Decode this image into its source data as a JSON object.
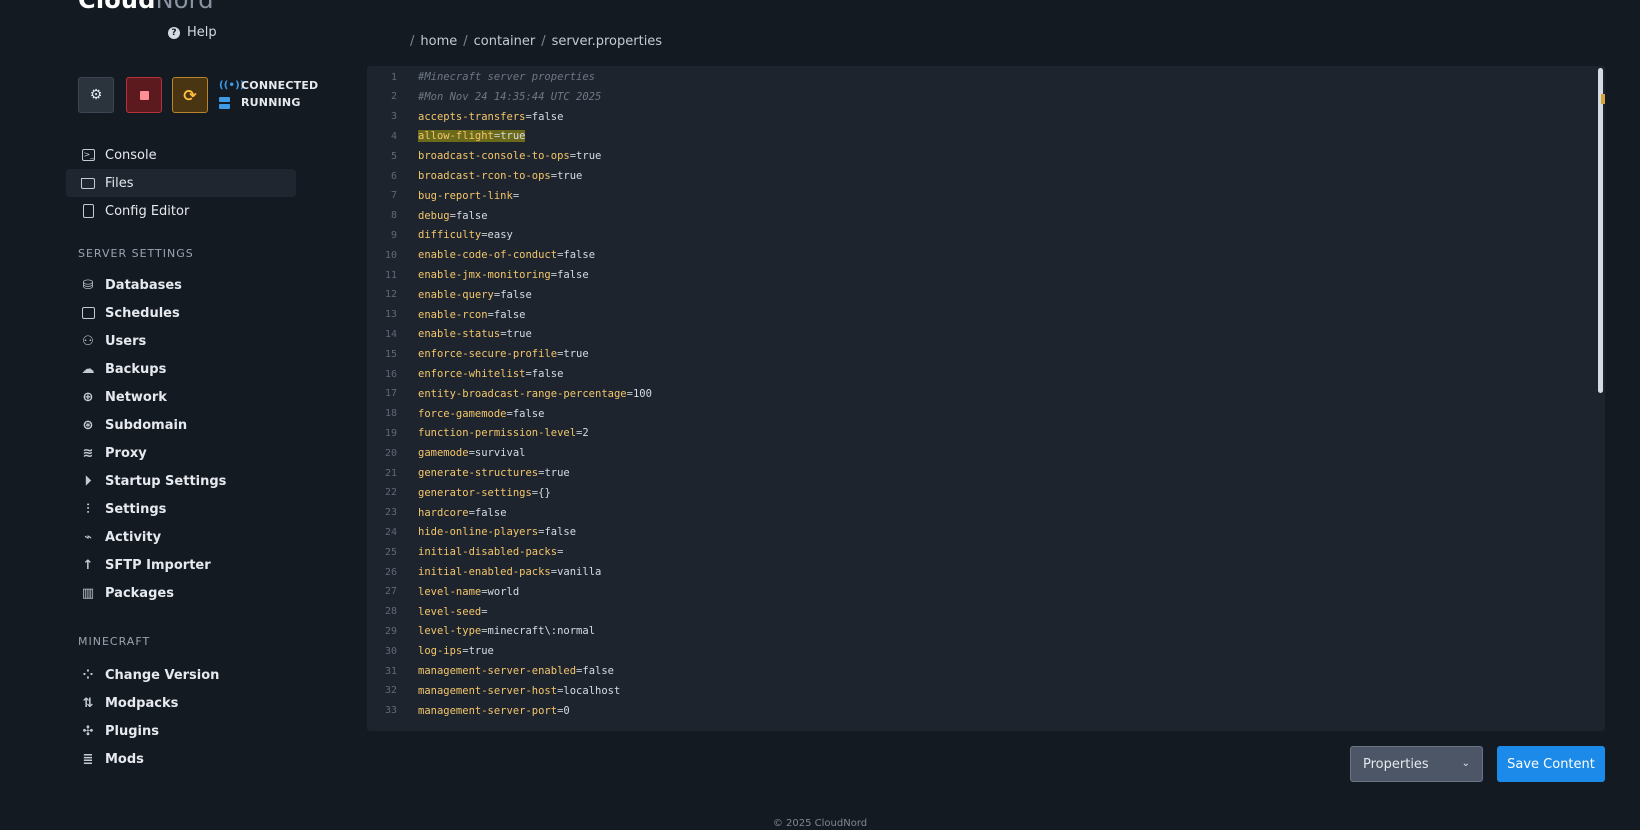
{
  "brand": {
    "primary": "Cloud",
    "secondary": "Nord"
  },
  "help_label": "Help",
  "controls": {
    "gear_icon": "gear-icon",
    "stop_icon": "stop-icon",
    "restart_icon": "restart-icon"
  },
  "status": {
    "connection": "CONNECTED",
    "state": "RUNNING",
    "accent": "#3d9be8"
  },
  "nav_top": [
    {
      "label": "Console",
      "icon": "terminal-icon"
    },
    {
      "label": "Files",
      "icon": "folder-icon",
      "active": true
    },
    {
      "label": "Config Editor",
      "icon": "clipboard-icon"
    }
  ],
  "section_server": "SERVER SETTINGS",
  "nav_server": [
    {
      "label": "Databases",
      "icon": "database-icon"
    },
    {
      "label": "Schedules",
      "icon": "calendar-icon"
    },
    {
      "label": "Users",
      "icon": "users-icon"
    },
    {
      "label": "Backups",
      "icon": "cloud-upload-icon"
    },
    {
      "label": "Network",
      "icon": "globe-icon"
    },
    {
      "label": "Subdomain",
      "icon": "network-icon"
    },
    {
      "label": "Proxy",
      "icon": "wifi-icon"
    },
    {
      "label": "Startup Settings",
      "icon": "play-circle-icon"
    },
    {
      "label": "Settings",
      "icon": "sliders-icon"
    },
    {
      "label": "Activity",
      "icon": "activity-icon"
    },
    {
      "label": "SFTP Importer",
      "icon": "arrow-up-icon"
    },
    {
      "label": "Packages",
      "icon": "chart-icon"
    }
  ],
  "section_minecraft": "MINECRAFT",
  "nav_minecraft": [
    {
      "label": "Change Version",
      "icon": "grid-icon"
    },
    {
      "label": "Modpacks",
      "icon": "sort-icon"
    },
    {
      "label": "Plugins",
      "icon": "puzzle-icon"
    },
    {
      "label": "Mods",
      "icon": "list-icon"
    }
  ],
  "breadcrumb": {
    "parts": [
      "home",
      "container",
      "server.properties"
    ]
  },
  "editor": {
    "highlight_line": 4,
    "lines": [
      {
        "n": "1",
        "comment": "#Minecraft server properties"
      },
      {
        "n": "2",
        "comment": "#Mon Nov 24 14:35:44 UTC 2025"
      },
      {
        "n": "3",
        "key": "accepts-transfers",
        "value": "false"
      },
      {
        "n": "4",
        "key": "allow-flight",
        "value": "true"
      },
      {
        "n": "5",
        "key": "broadcast-console-to-ops",
        "value": "true"
      },
      {
        "n": "6",
        "key": "broadcast-rcon-to-ops",
        "value": "true"
      },
      {
        "n": "7",
        "key": "bug-report-link",
        "value": ""
      },
      {
        "n": "8",
        "key": "debug",
        "value": "false"
      },
      {
        "n": "9",
        "key": "difficulty",
        "value": "easy"
      },
      {
        "n": "10",
        "key": "enable-code-of-conduct",
        "value": "false"
      },
      {
        "n": "11",
        "key": "enable-jmx-monitoring",
        "value": "false"
      },
      {
        "n": "12",
        "key": "enable-query",
        "value": "false"
      },
      {
        "n": "13",
        "key": "enable-rcon",
        "value": "false"
      },
      {
        "n": "14",
        "key": "enable-status",
        "value": "true"
      },
      {
        "n": "15",
        "key": "enforce-secure-profile",
        "value": "true"
      },
      {
        "n": "16",
        "key": "enforce-whitelist",
        "value": "false"
      },
      {
        "n": "17",
        "key": "entity-broadcast-range-percentage",
        "value": "100"
      },
      {
        "n": "18",
        "key": "force-gamemode",
        "value": "false"
      },
      {
        "n": "19",
        "key": "function-permission-level",
        "value": "2"
      },
      {
        "n": "20",
        "key": "gamemode",
        "value": "survival"
      },
      {
        "n": "21",
        "key": "generate-structures",
        "value": "true"
      },
      {
        "n": "22",
        "key": "generator-settings",
        "value": "{}"
      },
      {
        "n": "23",
        "key": "hardcore",
        "value": "false"
      },
      {
        "n": "24",
        "key": "hide-online-players",
        "value": "false"
      },
      {
        "n": "25",
        "key": "initial-disabled-packs",
        "value": ""
      },
      {
        "n": "26",
        "key": "initial-enabled-packs",
        "value": "vanilla"
      },
      {
        "n": "27",
        "key": "level-name",
        "value": "world"
      },
      {
        "n": "28",
        "key": "level-seed",
        "value": ""
      },
      {
        "n": "29",
        "key": "level-type",
        "value": "minecraft\\:normal"
      },
      {
        "n": "30",
        "key": "log-ips",
        "value": "true"
      },
      {
        "n": "31",
        "key": "management-server-enabled",
        "value": "false"
      },
      {
        "n": "32",
        "key": "management-server-host",
        "value": "localhost"
      },
      {
        "n": "33",
        "key": "management-server-port",
        "value": "0"
      }
    ]
  },
  "file_type_select": {
    "value": "Properties"
  },
  "save_label": "Save Content",
  "footer": "© 2025 CloudNord"
}
